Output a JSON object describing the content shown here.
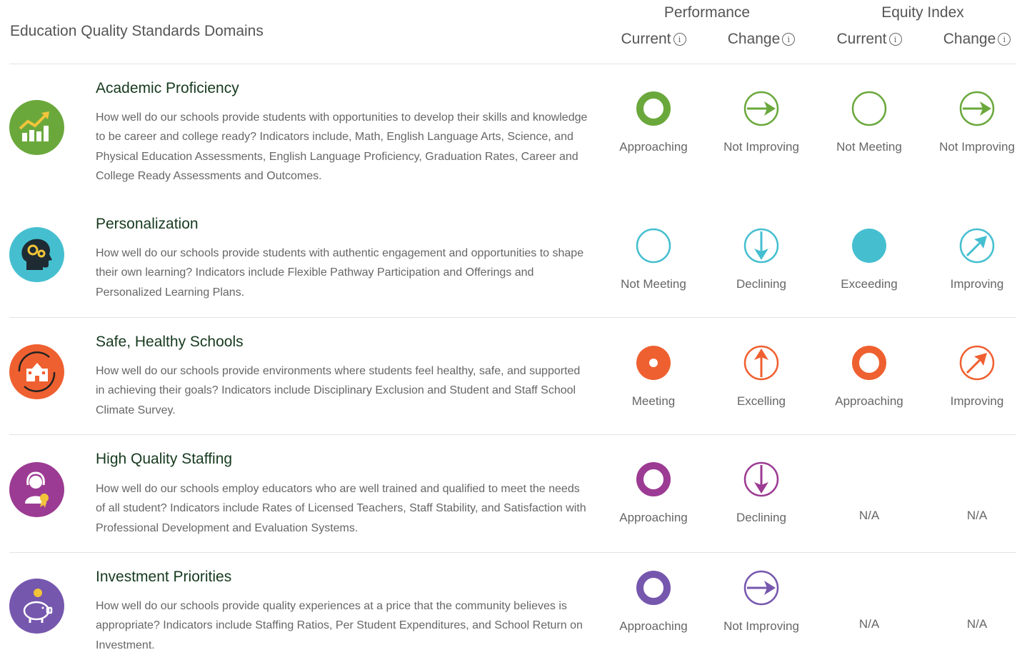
{
  "header": {
    "title": "Education Quality Standards Domains",
    "groups": [
      "Performance",
      "Equity Index"
    ],
    "columns": [
      "Current",
      "Change",
      "Current",
      "Change"
    ],
    "info_glyph": "i"
  },
  "rows": [
    {
      "title": "Academic Proficiency",
      "description": "How well do our schools provide students with opportunities to develop their skills and knowledge to be career and college ready? Indicators include, Math, English Language Arts, Science, and Physical Education Assessments, English Language Proficiency, Graduation Rates, Career and College Ready Assessments and Outcomes.",
      "icon": "bar-chart-growth-icon",
      "color": "#6aa83c",
      "cells": [
        {
          "label": "Approaching",
          "icon": "ring-thick"
        },
        {
          "label": "Not Improving",
          "icon": "arrow-right"
        },
        {
          "label": "Not Meeting",
          "icon": "ring-thin"
        },
        {
          "label": "Not Improving",
          "icon": "arrow-right"
        }
      ]
    },
    {
      "title": "Personalization",
      "description": "How well do our schools provide students with authentic engagement and opportunities to shape their own learning? Indicators include Flexible Pathway Participation and Offerings and Personalized Learning Plans.",
      "icon": "head-gears-icon",
      "color": "#45bfd0",
      "cells": [
        {
          "label": "Not Meeting",
          "icon": "ring-thin"
        },
        {
          "label": "Declining",
          "icon": "arrow-down"
        },
        {
          "label": "Exceeding",
          "icon": "filled"
        },
        {
          "label": "Improving",
          "icon": "arrow-up-right"
        }
      ]
    },
    {
      "title": "Safe, Healthy Schools",
      "description": "How well do our schools provide environments where students feel healthy, safe, and supported in achieving their goals? Indicators include Disciplinary Exclusion and Student and Staff School Climate Survey.",
      "icon": "school-building-icon",
      "color": "#ef6030",
      "cells": [
        {
          "label": "Meeting",
          "icon": "ring-dot"
        },
        {
          "label": "Excelling",
          "icon": "arrow-up"
        },
        {
          "label": "Approaching",
          "icon": "ring-thick"
        },
        {
          "label": "Improving",
          "icon": "arrow-up-right"
        }
      ]
    },
    {
      "title": "High Quality Staffing",
      "description": "How well do our schools employ educators who are well trained and qualified to meet the needs of all student? Indicators include Rates of Licensed Teachers, Staff Stability, and Satisfaction with Professional Development and Evaluation Systems.",
      "icon": "teacher-award-icon",
      "color": "#9c3b93",
      "cells": [
        {
          "label": "Approaching",
          "icon": "ring-thick"
        },
        {
          "label": "Declining",
          "icon": "arrow-down"
        },
        {
          "label": "N/A",
          "icon": "none"
        },
        {
          "label": "N/A",
          "icon": "none"
        }
      ]
    },
    {
      "title": "Investment Priorities",
      "description": "How well do our schools provide quality experiences at a price that the community believes is appropriate? Indicators include Staffing Ratios, Per Student Expenditures, and School Return on Investment.",
      "icon": "piggy-bank-icon",
      "color": "#7657ae",
      "cells": [
        {
          "label": "Approaching",
          "icon": "ring-thick"
        },
        {
          "label": "Not Improving",
          "icon": "arrow-right"
        },
        {
          "label": "N/A",
          "icon": "none"
        },
        {
          "label": "N/A",
          "icon": "none"
        }
      ]
    }
  ]
}
